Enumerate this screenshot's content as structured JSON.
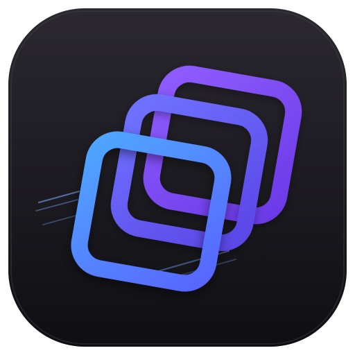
{
  "app_icon": {
    "icon_name": "stacked-windows-app-icon",
    "colors": {
      "background_top": "#2b2830",
      "background_bottom": "#0f0f13",
      "back_frame_a": "#8f5cff",
      "back_frame_b": "#6b39e6",
      "middle_frame_a": "#6f73ff",
      "middle_frame_b": "#5b45e6",
      "front_frame_a": "#4fa6ff",
      "front_frame_b": "#5865ff",
      "motion_lines": "#7aa9ff"
    }
  }
}
